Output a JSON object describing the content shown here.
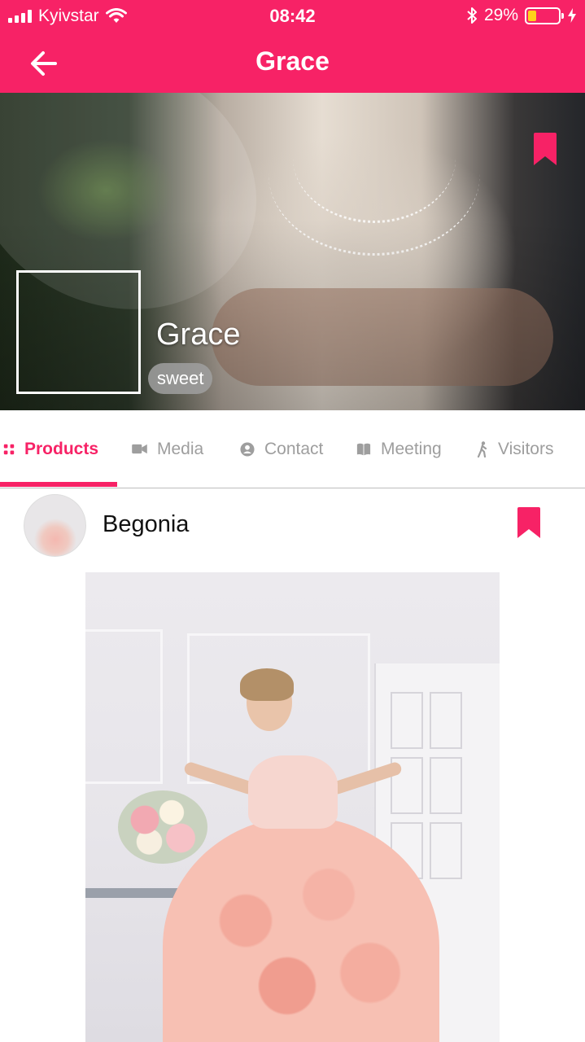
{
  "status_bar": {
    "carrier": "Kyivstar",
    "time": "08:42",
    "battery_percent": "29%",
    "battery_level": 0.29,
    "icons": [
      "signal-icon",
      "wifi-icon",
      "bluetooth-icon",
      "battery-icon",
      "charging-icon"
    ]
  },
  "nav": {
    "title": "Grace",
    "back_icon": "arrow-left-icon"
  },
  "profile": {
    "name": "Grace",
    "tag": "sweet",
    "bookmark_icon": "bookmark-icon"
  },
  "tabs": [
    {
      "label": "Products",
      "icon": "grid-icon",
      "active": true
    },
    {
      "label": "Media",
      "icon": "video-camera-icon",
      "active": false
    },
    {
      "label": "Contact",
      "icon": "user-circle-icon",
      "active": false
    },
    {
      "label": "Meeting",
      "icon": "open-book-icon",
      "active": false
    },
    {
      "label": "Visitors",
      "icon": "walking-person-icon",
      "active": false
    }
  ],
  "product": {
    "name": "Begonia",
    "bookmark_icon": "bookmark-icon"
  },
  "colors": {
    "accent": "#f72266",
    "inactive_tab": "#9e9e9e",
    "tag_background": "#a0a0a0"
  }
}
